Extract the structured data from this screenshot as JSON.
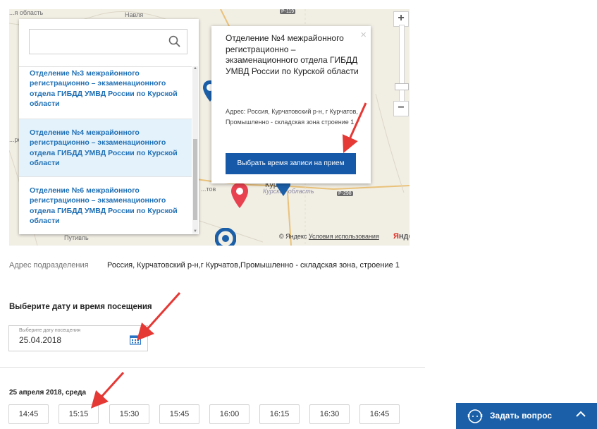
{
  "map": {
    "labels": {
      "top_left": "...я область",
      "navlya": "Навля",
      "road_r119": "Р-119",
      "troitsk": "...род",
      "kur": "Кур...",
      "kursk_oblast": "Курская область",
      "kurchatov": "...тов",
      "road_r298": "Р-298",
      "putivl": "Путивль"
    },
    "copyright": "© Яндекс",
    "terms": "Условия использования",
    "logo": "Яндекс",
    "pin_color": "#e8414f",
    "marker_color": "#1b5fa8"
  },
  "search": {
    "placeholder": "",
    "value": ""
  },
  "offices": [
    {
      "name": "Отделение №3 межрайонного регистрационно – экзаменационного отдела ГИБДД УМВД России по Курской области"
    },
    {
      "name": "Отделение №4 межрайонного регистрационно – экзаменационного отдела ГИБДД УМВД России по Курской области"
    },
    {
      "name": "Отделение №6 межрайонного регистрационно – экзаменационного отдела ГИБДД УМВД России по Курской области"
    }
  ],
  "popup": {
    "title": "Отделение №4 межрайонного регистрационно – экзаменационного отдела ГИБДД УМВД России по Курской области",
    "address": "Адрес: Россия, Курчатовский р-н, г Курчатов, Промышленно - складская зона строение 1",
    "button": "Выбрать время записи на прием",
    "close": "×"
  },
  "zoom": {
    "plus": "+",
    "minus": "−"
  },
  "address": {
    "label": "Адрес подразделения",
    "value": "Россия, Курчатовский р-н,г Курчатов,Промышленно - складская зона, строение 1"
  },
  "visit": {
    "heading": "Выберите дату и время посещения",
    "date_placeholder": "Выберите дату посещения",
    "date_value": "25.04.2018"
  },
  "slots": {
    "day": "25 апреля 2018, среда",
    "times": [
      "14:45",
      "15:15",
      "15:30",
      "15:45",
      "16:00",
      "16:15",
      "16:30",
      "16:45"
    ]
  },
  "ask": {
    "label": "Задать вопрос"
  },
  "colors": {
    "link": "#1f6fb4",
    "button": "#1659a8",
    "selected_bg": "#e3f2fb",
    "arrow": "#e53935"
  }
}
